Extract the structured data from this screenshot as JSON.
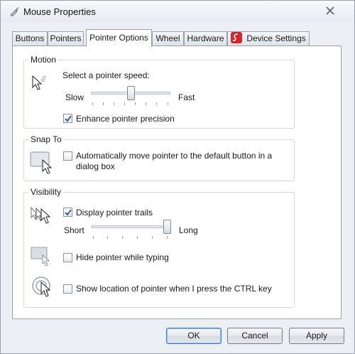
{
  "window": {
    "title": "Mouse Properties",
    "title_icon": "mouse-icon",
    "close_icon": "close-icon"
  },
  "tabs": [
    {
      "label": "Buttons",
      "active": false
    },
    {
      "label": "Pointers",
      "active": false
    },
    {
      "label": "Pointer Options",
      "active": true
    },
    {
      "label": "Wheel",
      "active": false
    },
    {
      "label": "Hardware",
      "active": false
    },
    {
      "label": "Device Settings",
      "active": false,
      "icon": "synaptics-icon"
    }
  ],
  "motion": {
    "legend": "Motion",
    "speed_label": "Select a pointer speed:",
    "slow_label": "Slow",
    "fast_label": "Fast",
    "speed_value": 0.5,
    "enhance_label": "Enhance pointer precision",
    "enhance_checked": true,
    "icon": "pointer-speed-icon"
  },
  "snap": {
    "legend": "Snap To",
    "checkbox_label_line1": "Automatically move pointer to the default button in a",
    "checkbox_label_line2": "dialog box",
    "checked": false,
    "icon": "snap-to-button-icon"
  },
  "visibility": {
    "legend": "Visibility",
    "trails_label": "Display pointer trails",
    "trails_checked": true,
    "short_label": "Short",
    "long_label": "Long",
    "trail_length_value": 1.0,
    "hide_label": "Hide pointer while typing",
    "hide_checked": false,
    "ctrl_label": "Show location of pointer when I press the CTRL key",
    "ctrl_checked": false,
    "trails_icon": "pointer-trails-icon",
    "hide_icon": "hide-pointer-icon",
    "ctrl_icon": "pointer-location-icon"
  },
  "buttons": {
    "ok": "OK",
    "cancel": "Cancel",
    "apply": "Apply"
  },
  "colors": {
    "accent": "#3a7bc8",
    "badge": "#d6242b",
    "check": "#2b4f9e"
  }
}
